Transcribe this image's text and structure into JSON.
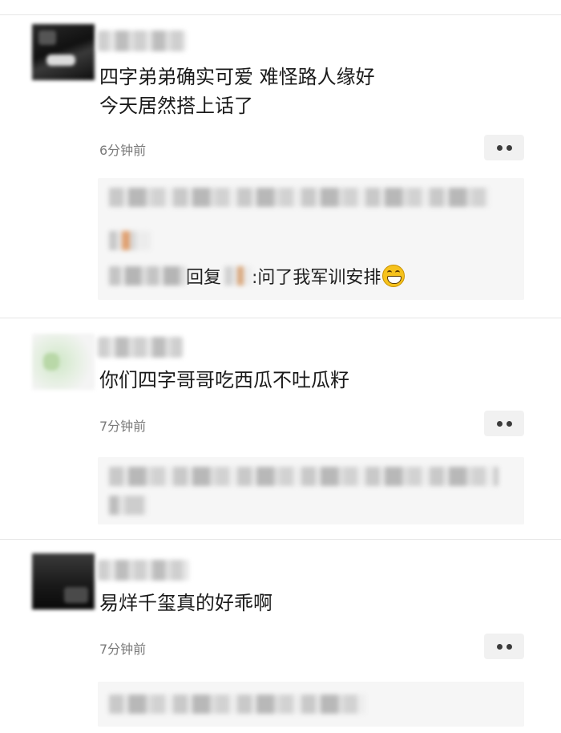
{
  "comments": [
    {
      "text_lines": [
        "四字弟弟确实可爱 难怪路人缘好",
        "今天居然搭上话了"
      ],
      "time": "6分钟前",
      "reply": {
        "label": "回复",
        "text": ":问了我军训安排",
        "emoji": "grin-icon"
      }
    },
    {
      "text_lines": [
        "你们四字哥哥吃西瓜不吐瓜籽"
      ],
      "time": "7分钟前"
    },
    {
      "text_lines": [
        "易烊千玺真的好乖啊"
      ],
      "time": "7分钟前"
    }
  ],
  "colors": {
    "background": "#ffffff",
    "divider": "#e6e6e6",
    "reply_box": "#f6f6f6",
    "timestamp": "#7a7a7a",
    "emoji_yellow": "#f6c21c"
  }
}
